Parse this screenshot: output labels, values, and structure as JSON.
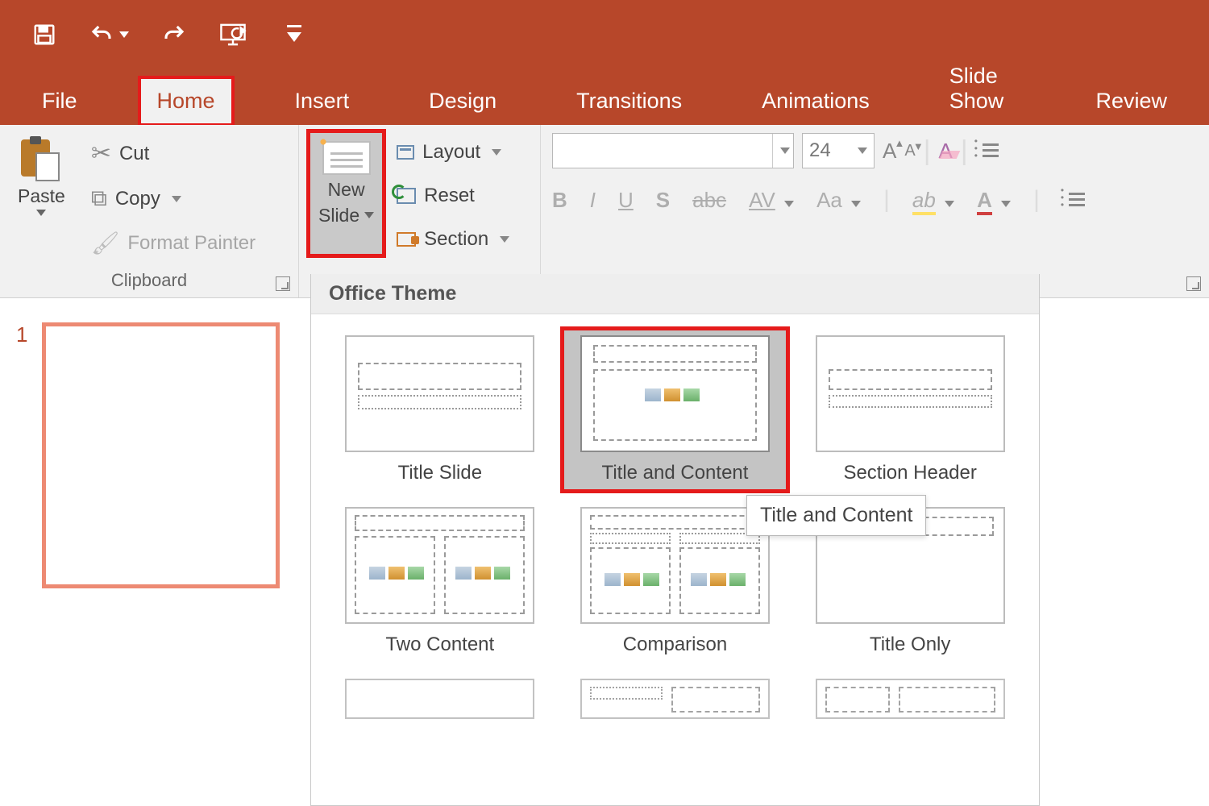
{
  "qat": {
    "save": "save",
    "undo": "undo",
    "redo": "redo",
    "slideshow": "start-from-beginning",
    "customize": "customize-qat"
  },
  "tabs": {
    "items": [
      "File",
      "Home",
      "Insert",
      "Design",
      "Transitions",
      "Animations",
      "Slide Show",
      "Review"
    ],
    "active_index": 1
  },
  "ribbon": {
    "clipboard": {
      "group_label": "Clipboard",
      "paste": "Paste",
      "cut": "Cut",
      "copy": "Copy",
      "format_painter": "Format Painter"
    },
    "slides": {
      "new_slide_line1": "New",
      "new_slide_line2": "Slide",
      "layout": "Layout",
      "reset": "Reset",
      "section": "Section"
    },
    "font": {
      "font_name": "",
      "font_size": "24",
      "bold": "B",
      "italic": "I",
      "underline": "U",
      "shadow": "S",
      "strike": "abc",
      "charspacing": "AV",
      "case": "Aa",
      "highlight": "ab",
      "fontcolor": "A"
    }
  },
  "gallery": {
    "header": "Office Theme",
    "items": [
      "Title Slide",
      "Title and Content",
      "Section Header",
      "Two Content",
      "Comparison",
      "Title Only"
    ],
    "selected_index": 1,
    "tooltip": "Title and Content"
  },
  "slidepanel": {
    "current_slide_number": "1"
  }
}
